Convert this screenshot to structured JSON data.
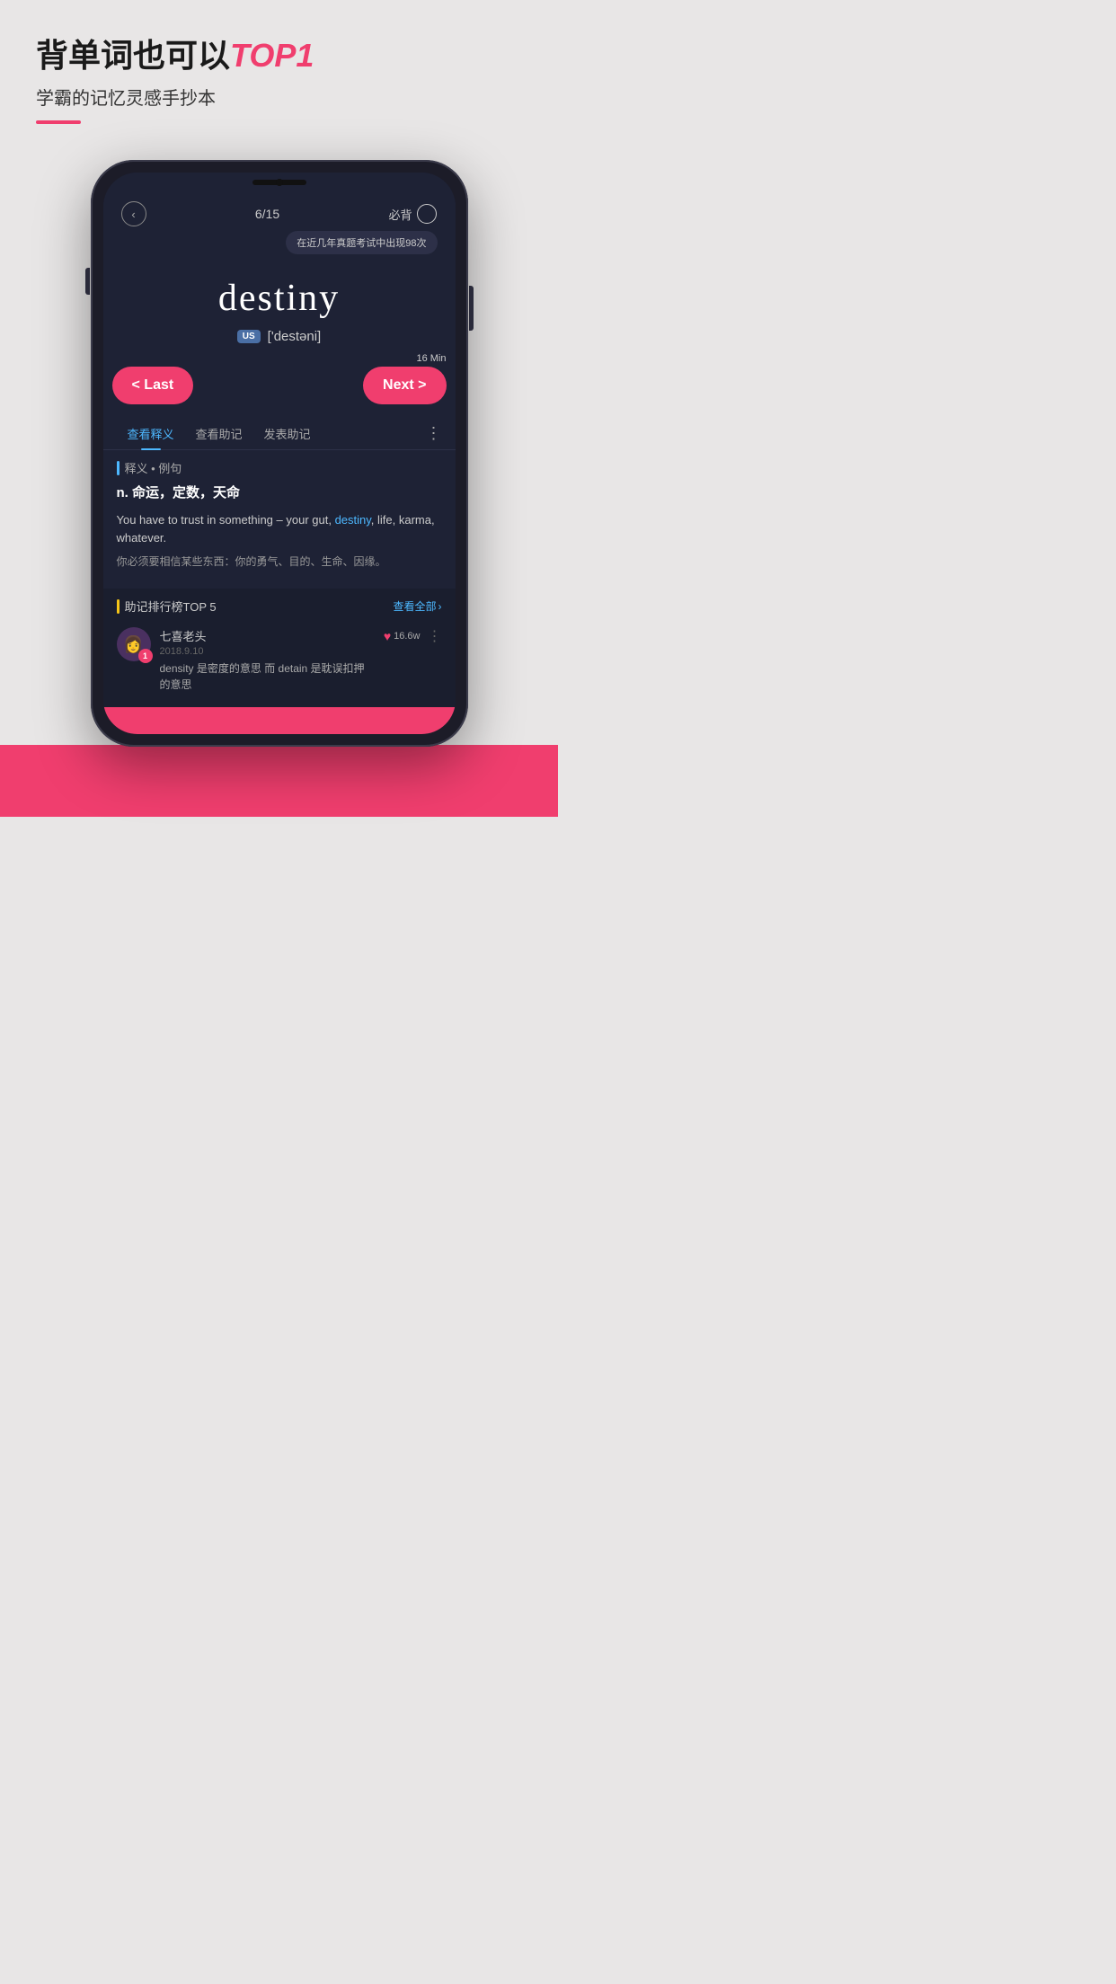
{
  "app": {
    "headline_part1": "背单词也可以",
    "headline_accent": "TOP1",
    "subtitle": "学霸的记忆灵感手抄本"
  },
  "phone": {
    "nav": {
      "back_icon": "‹",
      "progress": "6/15",
      "bookmark_label": "必背"
    },
    "tooltip": "在近几年真题考试中出现98次",
    "word": {
      "text": "destiny",
      "us_label": "US",
      "phonetic": "['destəni]"
    },
    "time_label": "16 Min",
    "buttons": {
      "last": "< Last",
      "next": "Next >"
    },
    "tabs": [
      {
        "label": "查看释义",
        "active": true
      },
      {
        "label": "查看助记",
        "active": false
      },
      {
        "label": "发表助记",
        "active": false
      },
      {
        "label": "⋮",
        "active": false
      }
    ],
    "section_label": "释义 • 例句",
    "definition": {
      "part_of_speech": "n.",
      "meaning": "命运，定数，天命",
      "example_en_before": "You have to trust in something – your gut, ",
      "example_en_word": "destiny",
      "example_en_after": ", life, karma, whatever.",
      "example_zh": "你必须要相信某些东西：你的勇气、目的、生命、因缘。"
    },
    "ranking": {
      "title": "助记排行榜TOP 5",
      "view_all": "查看全部",
      "user": {
        "name": "七喜老头",
        "date": "2018.9.10",
        "rank": "1",
        "content": "density 是密度的意思  而 detain 是耽误扣押的意思",
        "likes": "16.6w"
      }
    }
  }
}
